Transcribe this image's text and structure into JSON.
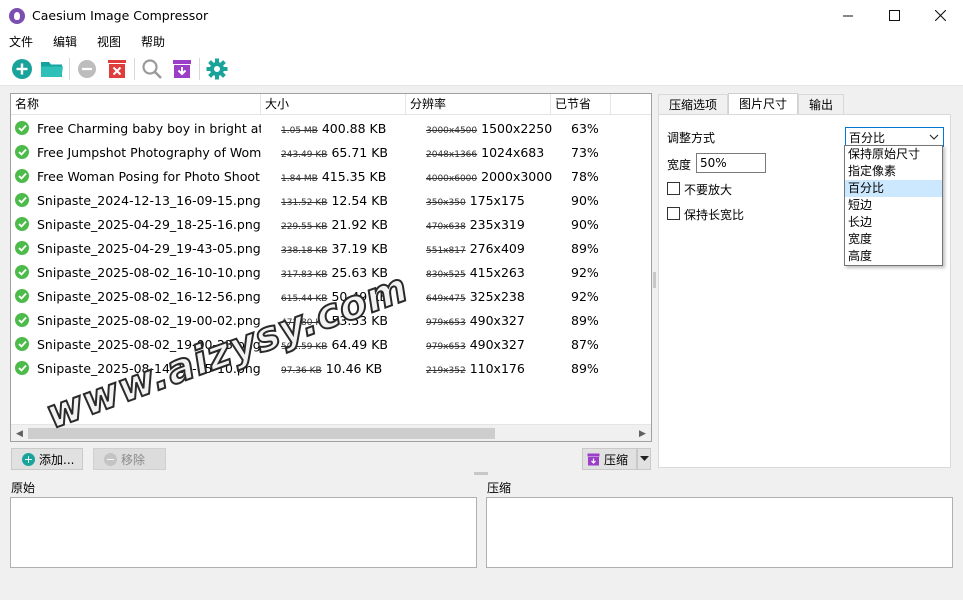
{
  "window": {
    "title": "Caesium Image Compressor",
    "minimize": "—",
    "maximize": "☐",
    "close": "✕"
  },
  "menu": [
    {
      "label": "文件"
    },
    {
      "label": "编辑"
    },
    {
      "label": "视图"
    },
    {
      "label": "帮助"
    }
  ],
  "toolbar": {
    "icons": [
      "add-icon",
      "folder-icon",
      "remove-icon",
      "clear-icon",
      "search-icon",
      "archive-icon",
      "settings-icon"
    ]
  },
  "columns": {
    "name": "名称",
    "size": "大小",
    "resolution": "分辨率",
    "saved": "已节省"
  },
  "rows": [
    {
      "name": "Free Charming baby boy in bright attire",
      "old_size": "1.05 MB",
      "new_size": "400.88 KB",
      "old_res": "3000x4500",
      "new_res": "1500x2250",
      "saved": "63%"
    },
    {
      "name": "Free Jumpshot Photography of Woman",
      "old_size": "243.49 KB",
      "new_size": "65.71 KB",
      "old_res": "2048x1366",
      "new_res": "1024x683",
      "saved": "73%"
    },
    {
      "name": "Free Woman Posing for Photo Shoot S",
      "old_size": "1.84 MB",
      "new_size": "415.35 KB",
      "old_res": "4000x6000",
      "new_res": "2000x3000",
      "saved": "78%"
    },
    {
      "name": "Snipaste_2024-12-13_16-09-15.png",
      "old_size": "131.52 KB",
      "new_size": "12.54 KB",
      "old_res": "350x350",
      "new_res": "175x175",
      "saved": "90%"
    },
    {
      "name": "Snipaste_2025-04-29_18-25-16.png",
      "old_size": "229.55 KB",
      "new_size": "21.92 KB",
      "old_res": "470x638",
      "new_res": "235x319",
      "saved": "90%"
    },
    {
      "name": "Snipaste_2025-04-29_19-43-05.png",
      "old_size": "338.18 KB",
      "new_size": "37.19 KB",
      "old_res": "551x817",
      "new_res": "276x409",
      "saved": "89%"
    },
    {
      "name": "Snipaste_2025-08-02_16-10-10.png",
      "old_size": "317.83 KB",
      "new_size": "25.63 KB",
      "old_res": "830x525",
      "new_res": "415x263",
      "saved": "92%"
    },
    {
      "name": "Snipaste_2025-08-02_16-12-56.png",
      "old_size": "615.44 KB",
      "new_size": "50.49 KB",
      "old_res": "649x475",
      "new_res": "325x238",
      "saved": "92%"
    },
    {
      "name": "Snipaste_2025-08-02_19-00-02.png",
      "old_size": "472.80 KB",
      "new_size": "53.53 KB",
      "old_res": "979x653",
      "new_res": "490x327",
      "saved": "89%"
    },
    {
      "name": "Snipaste_2025-08-02_19-00-23.png",
      "old_size": "501.59 KB",
      "new_size": "64.49 KB",
      "old_res": "979x653",
      "new_res": "490x327",
      "saved": "87%"
    },
    {
      "name": "Snipaste_2025-08-14_16-05-10.png",
      "old_size": "97.36 KB",
      "new_size": "10.46 KB",
      "old_res": "219x352",
      "new_res": "110x176",
      "saved": "89%"
    }
  ],
  "buttons": {
    "add": "添加...",
    "remove": "移除",
    "compress": "压缩"
  },
  "tabs": [
    {
      "label": "压缩选项",
      "active": false
    },
    {
      "label": "图片尺寸",
      "active": true
    },
    {
      "label": "输出",
      "active": false
    }
  ],
  "resize": {
    "mode_label": "调整方式",
    "mode_value": "百分比",
    "width_label": "宽度",
    "width_value": "50%",
    "no_enlarge": "不要放大",
    "keep_ratio": "保持长宽比",
    "options": [
      "保持原始尺寸",
      "指定像素",
      "百分比",
      "短边",
      "长边",
      "宽度",
      "高度"
    ],
    "selected_index": 2
  },
  "preview": {
    "original": "原始",
    "compressed": "压缩"
  },
  "watermark": "www.aizysy.com",
  "colors": {
    "accent_teal": "#1aa39a",
    "folder_teal": "#14a3a0",
    "delete_red": "#e03c3c",
    "archive_purple": "#9b3fc9",
    "check_green": "#4cbb4a"
  }
}
